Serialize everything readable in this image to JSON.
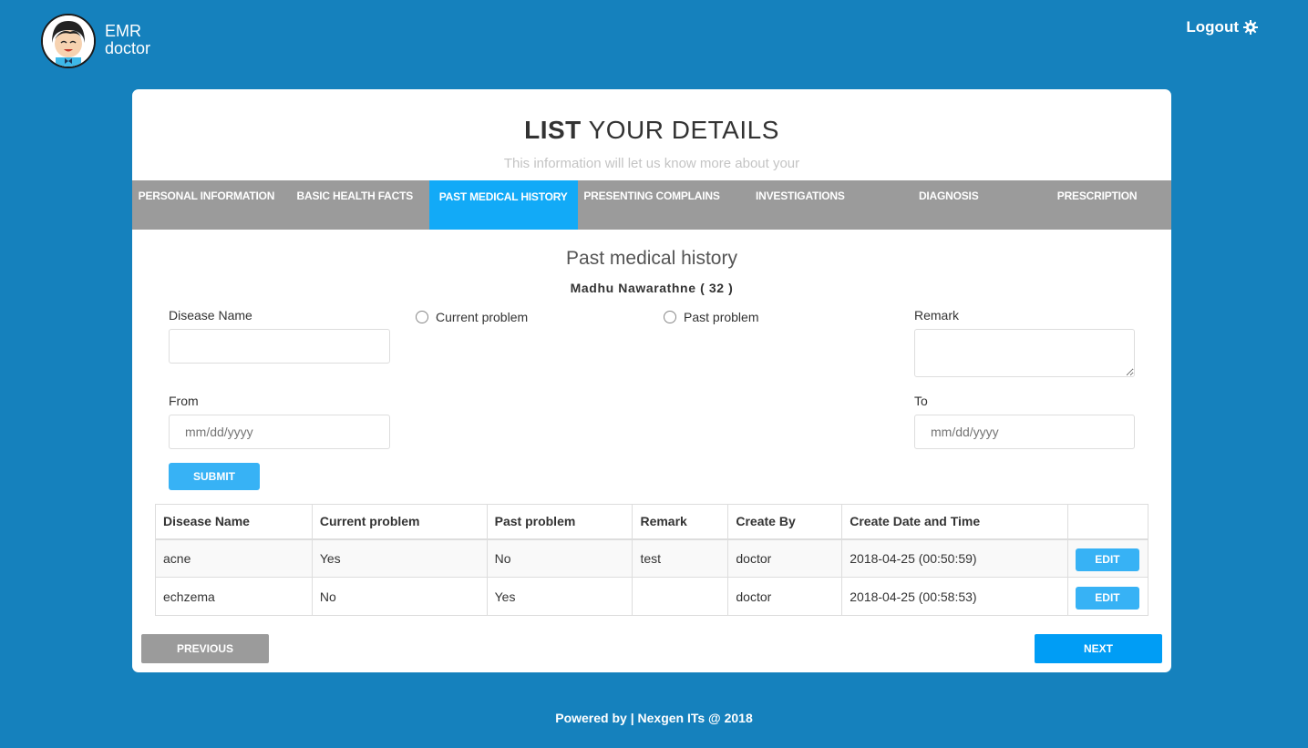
{
  "brand": {
    "line1": "EMR",
    "line2": "doctor"
  },
  "header": {
    "logout_label": "Logout",
    "logout_icon": "gear-icon"
  },
  "card": {
    "title_bold": "LIST",
    "title_light": "YOUR DETAILS",
    "subtitle": "This information will let us know more about your"
  },
  "tabs": [
    {
      "label": "PERSONAL INFORMATION",
      "active": false
    },
    {
      "label": "BASIC HEALTH FACTS",
      "active": false
    },
    {
      "label": "PAST MEDICAL HISTORY",
      "active": true
    },
    {
      "label": "PRESENTING COMPLAINS",
      "active": false
    },
    {
      "label": "INVESTIGATIONS",
      "active": false
    },
    {
      "label": "DIAGNOSIS",
      "active": false
    },
    {
      "label": "PRESCRIPTION",
      "active": false
    }
  ],
  "section": {
    "title": "Past medical history",
    "patient": "Madhu Nawarathne ( 32 )"
  },
  "form": {
    "disease_label": "Disease Name",
    "disease_value": "",
    "current_label": "Current problem",
    "past_label": "Past problem",
    "remark_label": "Remark",
    "from_label": "From",
    "from_placeholder": "mm/dd/yyyy",
    "to_label": "To",
    "to_placeholder": "mm/dd/yyyy",
    "submit_label": "SUBMIT"
  },
  "table": {
    "headers": [
      "Disease Name",
      "Current problem",
      "Past problem",
      "Remark",
      "Create By",
      "Create Date and Time",
      ""
    ],
    "rows": [
      [
        "acne",
        "Yes",
        "No",
        "test",
        "doctor",
        "2018-04-25 (00:50:59)"
      ],
      [
        "echzema",
        "No",
        "Yes",
        "",
        "doctor",
        "2018-04-25 (00:58:53)"
      ]
    ],
    "edit_label": "EDIT"
  },
  "nav": {
    "previous_label": "PREVIOUS",
    "next_label": "NEXT"
  },
  "footer": {
    "text": "Powered by | Nexgen ITs @ 2018"
  },
  "colors": {
    "background": "#1581bd",
    "accent": "#12aaf7",
    "tab_bg": "#9b9b9b"
  }
}
